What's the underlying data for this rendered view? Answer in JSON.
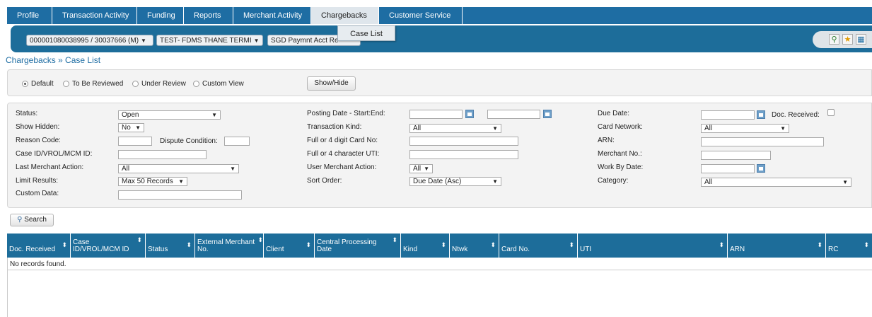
{
  "topnav": {
    "tabs": [
      {
        "label": "Profile"
      },
      {
        "label": "Transaction Activity"
      },
      {
        "label": "Funding"
      },
      {
        "label": "Reports"
      },
      {
        "label": "Merchant Activity"
      },
      {
        "label": "Chargebacks"
      },
      {
        "label": "Customer Service"
      }
    ],
    "active": "Chargebacks"
  },
  "toolbar": {
    "account_select": "000001080038995 / 30037666 (M)",
    "terminal_select": "TEST- FDMS THANE TERMI",
    "payment_select": "SGD Paymnt Acct Re"
  },
  "dropdown": {
    "item": "Case List"
  },
  "breadcrumb": "Chargebacks » Case List",
  "views": {
    "options": [
      "Default",
      "To Be Reviewed",
      "Under Review",
      "Custom View"
    ],
    "selected": "Default",
    "show_hide": "Show/Hide"
  },
  "filters": {
    "status_label": "Status:",
    "status_value": "Open",
    "show_hidden_label": "Show Hidden:",
    "show_hidden_value": "No",
    "reason_code_label": "Reason Code:",
    "dispute_condition_label": "Dispute Condition:",
    "case_id_label": "Case ID/VROL/MCM ID:",
    "last_merchant_action_label": "Last Merchant Action:",
    "last_merchant_action_value": "All",
    "limit_results_label": "Limit Results:",
    "limit_results_value": "Max 50 Records",
    "custom_data_label": "Custom Data:",
    "posting_date_label": "Posting Date - Start:End:",
    "transaction_kind_label": "Transaction Kind:",
    "transaction_kind_value": "All",
    "card_no_label": "Full or 4 digit Card No:",
    "uti_label": "Full or 4 character UTI:",
    "user_merchant_action_label": "User Merchant Action:",
    "user_merchant_action_value": "All",
    "sort_order_label": "Sort Order:",
    "sort_order_value": "Due Date (Asc)",
    "due_date_label": "Due Date:",
    "doc_received_label": "Doc. Received:",
    "card_network_label": "Card Network:",
    "card_network_value": "All",
    "arn_label": "ARN:",
    "merchant_no_label": "Merchant No.:",
    "work_by_date_label": "Work By Date:",
    "category_label": "Category:",
    "category_value": "All"
  },
  "search_button": "Search",
  "table": {
    "columns": [
      {
        "line1": "",
        "line2": "Doc. Received"
      },
      {
        "line1": "Case",
        "line2": "ID/VROL/MCM ID"
      },
      {
        "line1": "",
        "line2": "Status"
      },
      {
        "line1": "External Merchant",
        "line2": "No."
      },
      {
        "line1": "",
        "line2": "Client"
      },
      {
        "line1": "Central Processing",
        "line2": "Date"
      },
      {
        "line1": "",
        "line2": "Kind"
      },
      {
        "line1": "",
        "line2": "Ntwk"
      },
      {
        "line1": "",
        "line2": "Card No."
      },
      {
        "line1": "",
        "line2": "UTI"
      },
      {
        "line1": "",
        "line2": "ARN"
      },
      {
        "line1": "",
        "line2": "RC"
      }
    ],
    "empty_message": "No records found."
  },
  "sort_glyph": "⬍",
  "icons": [
    "search-icon",
    "star-icon",
    "grid-icon",
    "magnifier-icon",
    "calendar-icon"
  ]
}
